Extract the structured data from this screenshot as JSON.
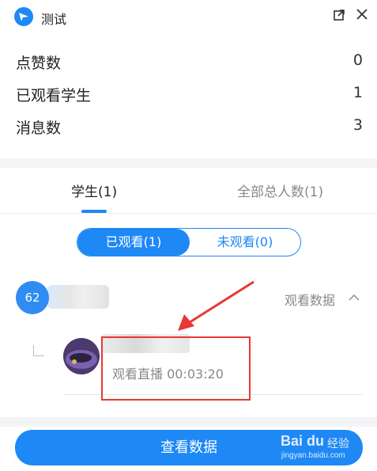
{
  "window": {
    "title": "测试",
    "logo_icon": "bird-logo-icon",
    "popout_icon": "popout-icon",
    "close_icon": "close-icon"
  },
  "stats": [
    {
      "label": "点赞数",
      "value": "0"
    },
    {
      "label": "已观看学生",
      "value": "1"
    },
    {
      "label": "消息数",
      "value": "3"
    }
  ],
  "tabs": [
    {
      "label": "学生(1)",
      "active": true
    },
    {
      "label": "全部总人数(1)",
      "active": false
    }
  ],
  "segmented": {
    "watched_label": "已观看(1)",
    "unwatched_label": "未观看(0)",
    "selected": "watched"
  },
  "group": {
    "badge": "62",
    "watch_data_label": "观看数据",
    "expanded": true
  },
  "student": {
    "status": "观看直播 00:03:20"
  },
  "footer": {
    "button_label": "查看数据"
  },
  "watermark": {
    "logo_text": "Bai du",
    "text": "经验",
    "url": "jingyan.baidu.com"
  },
  "colors": {
    "accent": "#1e88f5",
    "annotation": "#e53935",
    "muted_text": "#888888"
  }
}
